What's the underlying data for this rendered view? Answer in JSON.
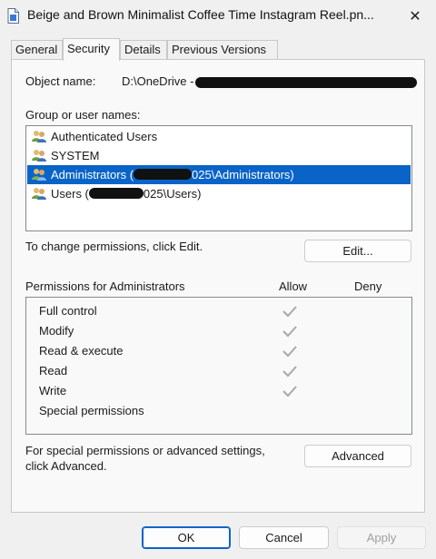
{
  "window": {
    "title": "Beige and Brown Minimalist Coffee Time Instagram Reel.pn...",
    "close_glyph": "✕"
  },
  "tabs": [
    {
      "label": "General"
    },
    {
      "label": "Security"
    },
    {
      "label": "Details"
    },
    {
      "label": "Previous Versions"
    }
  ],
  "security": {
    "object_name_label": "Object name:",
    "object_name_value": "D:\\OneDrive -",
    "group_label": "Group or user names:",
    "users": [
      {
        "name": "Authenticated Users"
      },
      {
        "name": "SYSTEM"
      },
      {
        "name": "Administrators (",
        "suffix": "025\\Administrators)"
      },
      {
        "name": "Users (",
        "suffix": "025\\Users)"
      }
    ],
    "selected_user_index": 2,
    "change_text": "To change permissions, click Edit.",
    "edit_button": "Edit...",
    "permissions_for": "Permissions for Administrators",
    "allow_header": "Allow",
    "deny_header": "Deny",
    "permissions": [
      {
        "name": "Full control",
        "allow": true,
        "deny": false
      },
      {
        "name": "Modify",
        "allow": true,
        "deny": false
      },
      {
        "name": "Read & execute",
        "allow": true,
        "deny": false
      },
      {
        "name": "Read",
        "allow": true,
        "deny": false
      },
      {
        "name": "Write",
        "allow": true,
        "deny": false
      },
      {
        "name": "Special permissions",
        "allow": false,
        "deny": false
      }
    ],
    "special_text_1": "For special permissions or advanced settings,",
    "special_text_2": "click Advanced.",
    "advanced_button": "Advanced"
  },
  "footer": {
    "ok": "OK",
    "cancel": "Cancel",
    "apply": "Apply"
  },
  "colors": {
    "selection": "#0a64c8",
    "checkmark": "#a8a8a8"
  }
}
